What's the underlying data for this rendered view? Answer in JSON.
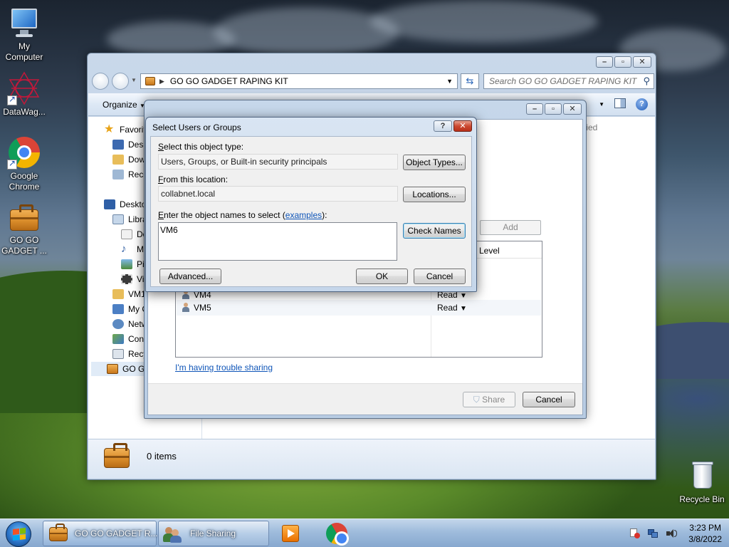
{
  "desktop": {
    "icons": [
      {
        "label": "My Computer"
      },
      {
        "label": "DataWag..."
      },
      {
        "label": "Google Chrome"
      },
      {
        "label": "GO GO GADGET ..."
      },
      {
        "label": "Recycle Bin"
      }
    ]
  },
  "explorer": {
    "address": "GO GO GADGET RAPING KIT",
    "search_placeholder": "Search GO GO GADGET RAPING KIT",
    "organize_label": "Organize",
    "nav_items": [
      {
        "label": "Favorit",
        "icon": "star-icon"
      },
      {
        "label": "Desk",
        "icon": "desktop-folder-icon"
      },
      {
        "label": "Dow",
        "icon": "downloads-icon"
      },
      {
        "label": "Rece",
        "icon": "recent-icon"
      },
      {
        "label": "Deskto",
        "icon": "desktop-icon"
      },
      {
        "label": "Libra",
        "icon": "library-icon"
      },
      {
        "label": "Do",
        "icon": "documents-icon"
      },
      {
        "label": "Mu",
        "icon": "music-icon"
      },
      {
        "label": "Pic",
        "icon": "pictures-icon"
      },
      {
        "label": "Vid",
        "icon": "videos-icon"
      },
      {
        "label": "VM1",
        "icon": "user-folder-icon"
      },
      {
        "label": "My C",
        "icon": "computer-icon"
      },
      {
        "label": "Netw",
        "icon": "network-icon"
      },
      {
        "label": "Cont",
        "icon": "control-panel-icon"
      },
      {
        "label": "Recy",
        "icon": "recycle-icon"
      },
      {
        "label": "GO G",
        "icon": "briefcase-icon"
      }
    ],
    "column_header_fragment": "fied",
    "status": "0 items"
  },
  "file_sharing": {
    "add_label": "Add",
    "level_header": "Level",
    "rows": [
      {
        "name": "VM4",
        "level": "Read"
      },
      {
        "name": "VM5",
        "level": "Read"
      }
    ],
    "trouble_link": "I'm having trouble sharing",
    "share_label": "Share",
    "cancel_label": "Cancel"
  },
  "select_dialog": {
    "title": "Select Users or Groups",
    "object_type_label_pre": "S",
    "object_type_label_post": "elect this object type:",
    "object_type_value": "Users, Groups, or Built-in security principals",
    "object_types_button": "Object Types...",
    "location_label_pre": "F",
    "location_label_post": "rom this location:",
    "location_value": "collabnet.local",
    "locations_button": "Locations...",
    "names_label_pre": "E",
    "names_label_mid": "nter the object names to select (",
    "names_label_link": "examples",
    "names_label_post": "):",
    "names_value": "VM6",
    "check_names_button": "Check Names",
    "advanced_button": "Advanced...",
    "ok_button": "OK",
    "cancel_button": "Cancel"
  },
  "taskbar": {
    "buttons": [
      {
        "label": "GO GO GADGET R..."
      },
      {
        "label": "File Sharing"
      }
    ],
    "time": "3:23 PM",
    "date": "3/8/2022"
  },
  "colors": {
    "link": "#0f55b8",
    "taskbar": "#9fbcdc",
    "window_frame": "#c6d7ea"
  }
}
